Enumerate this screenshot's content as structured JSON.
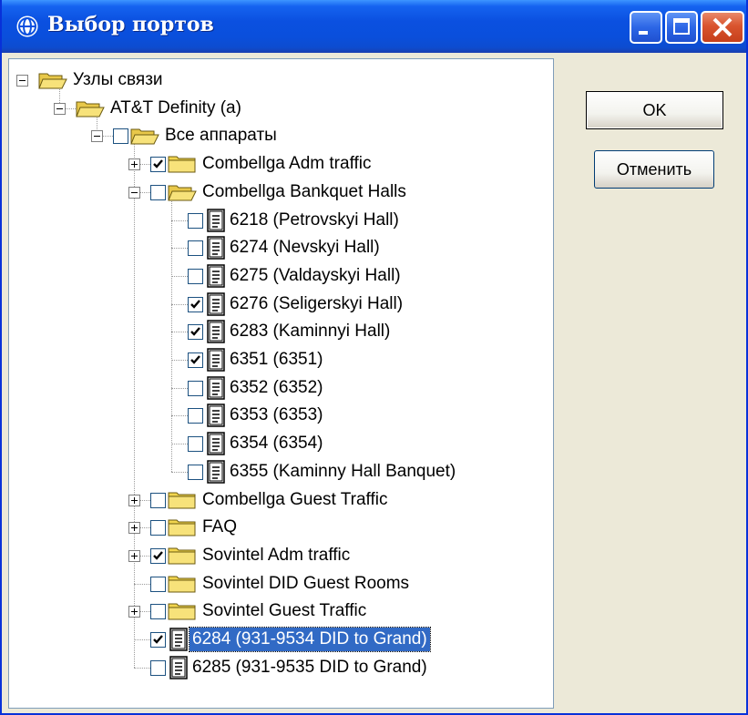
{
  "window": {
    "title": "Выбор портов",
    "icon": "globe-icon",
    "controls": [
      "minimize-icon",
      "maximize-icon",
      "close-icon"
    ],
    "accent_color": "#0a4fdc",
    "selection_color": "#316ac5"
  },
  "buttons": {
    "ok_label": "OK",
    "cancel_label": "Отменить"
  },
  "tree": {
    "nodes": [
      {
        "label": "Узлы связи",
        "level": 0,
        "icon": "folder-open-icon",
        "expander": "minus",
        "checkbox": false,
        "checked": false
      },
      {
        "label": "AT&T Definity (a)",
        "level": 1,
        "icon": "folder-open-icon",
        "expander": "minus",
        "checkbox": false,
        "checked": false
      },
      {
        "label": "Все аппараты",
        "level": 2,
        "icon": "folder-open-icon",
        "expander": "minus",
        "checkbox": true,
        "checked": false
      },
      {
        "label": "Combellga Adm traffic",
        "level": 3,
        "icon": "folder-icon",
        "expander": "plus",
        "checkbox": true,
        "checked": true
      },
      {
        "label": "Combellga Bankquet Halls",
        "level": 3,
        "icon": "folder-open-icon",
        "expander": "minus",
        "checkbox": true,
        "checked": false
      },
      {
        "label": "6218 (Petrovskyi Hall)",
        "level": 4,
        "icon": "document-icon",
        "expander": "none",
        "checkbox": true,
        "checked": false
      },
      {
        "label": "6274 (Nevskyi Hall)",
        "level": 4,
        "icon": "document-icon",
        "expander": "none",
        "checkbox": true,
        "checked": false
      },
      {
        "label": "6275 (Valdayskyi Hall)",
        "level": 4,
        "icon": "document-icon",
        "expander": "none",
        "checkbox": true,
        "checked": false
      },
      {
        "label": "6276 (Seligerskyi Hall)",
        "level": 4,
        "icon": "document-icon",
        "expander": "none",
        "checkbox": true,
        "checked": true
      },
      {
        "label": "6283 (Kaminnyi Hall)",
        "level": 4,
        "icon": "document-icon",
        "expander": "none",
        "checkbox": true,
        "checked": true
      },
      {
        "label": "6351 (6351)",
        "level": 4,
        "icon": "document-icon",
        "expander": "none",
        "checkbox": true,
        "checked": true
      },
      {
        "label": "6352 (6352)",
        "level": 4,
        "icon": "document-icon",
        "expander": "none",
        "checkbox": true,
        "checked": false
      },
      {
        "label": "6353 (6353)",
        "level": 4,
        "icon": "document-icon",
        "expander": "none",
        "checkbox": true,
        "checked": false
      },
      {
        "label": "6354 (6354)",
        "level": 4,
        "icon": "document-icon",
        "expander": "none",
        "checkbox": true,
        "checked": false
      },
      {
        "label": "6355 (Kaminny Hall Banquet)",
        "level": 4,
        "icon": "document-icon",
        "expander": "none",
        "checkbox": true,
        "checked": false
      },
      {
        "label": "Combellga Guest Traffic",
        "level": 3,
        "icon": "folder-icon",
        "expander": "plus",
        "checkbox": true,
        "checked": false
      },
      {
        "label": "FAQ",
        "level": 3,
        "icon": "folder-icon",
        "expander": "plus",
        "checkbox": true,
        "checked": false
      },
      {
        "label": "Sovintel Adm traffic",
        "level": 3,
        "icon": "folder-icon",
        "expander": "plus",
        "checkbox": true,
        "checked": true
      },
      {
        "label": "Sovintel DID Guest Rooms",
        "level": 3,
        "icon": "folder-icon",
        "expander": "none",
        "checkbox": true,
        "checked": false
      },
      {
        "label": "Sovintel Guest Traffic",
        "level": 3,
        "icon": "folder-icon",
        "expander": "plus",
        "checkbox": true,
        "checked": false
      },
      {
        "label": "6284 (931-9534 DID to Grand)",
        "level": 3,
        "icon": "document-icon",
        "expander": "none",
        "checkbox": true,
        "checked": true,
        "selected": true
      },
      {
        "label": "6285 (931-9535 DID to Grand)",
        "level": 3,
        "icon": "document-icon",
        "expander": "none",
        "checkbox": true,
        "checked": false
      }
    ]
  }
}
